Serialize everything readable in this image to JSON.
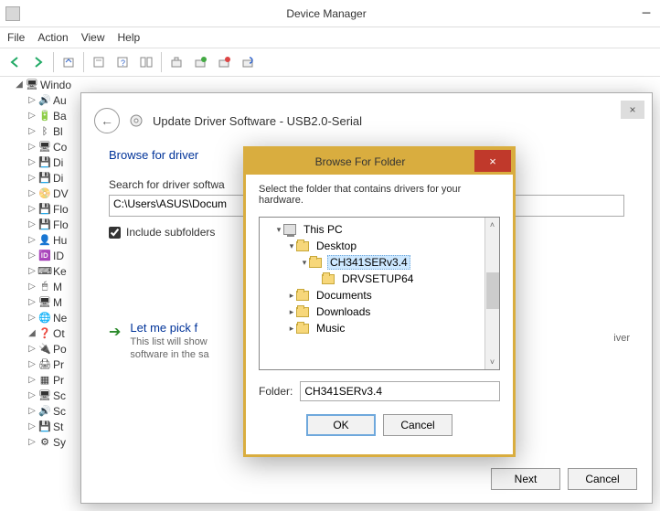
{
  "window": {
    "title": "Device Manager",
    "minimize": "−"
  },
  "menu": {
    "file": "File",
    "action": "Action",
    "view": "View",
    "help": "Help"
  },
  "toolbar_icons": {
    "back": "back-arrow",
    "fwd": "forward-arrow",
    "up": "up-arrow-device",
    "props": "properties",
    "scan": "scan-hardware",
    "refresh": "refresh",
    "details": "details",
    "resources": "resources",
    "uninstall": "uninstall",
    "update": "update-driver",
    "disable": "disable",
    "enable": "enable"
  },
  "tree": {
    "root": "Windo",
    "items": [
      "Au",
      "Ba",
      "Bl",
      "Co",
      "Di",
      "Di",
      "DV",
      "Flo",
      "Flo",
      "Hu",
      "ID",
      "Ke",
      "M",
      "M",
      "Ne",
      "Ot",
      "Po",
      "Pr",
      "Pr",
      "Sc",
      "Sc",
      "St",
      "Sy"
    ],
    "selected_index": 15
  },
  "update_dialog": {
    "close_x": "×",
    "title_prefix": "Update Driver Software - ",
    "title_device": "USB2.0-Serial",
    "heading": "Browse for driver",
    "search_label": "Search for driver softwa",
    "path_value": "C:\\Users\\ASUS\\Docum",
    "include_subfolders": "Include subfolders",
    "include_subfolders_checked": true,
    "pick_title": "Let me pick f",
    "pick_sub1": "This list will show",
    "pick_sub2": "software in the sa",
    "pick_sub_right": "iver",
    "next": "Next",
    "cancel": "Cancel"
  },
  "browse_dialog": {
    "title": "Browse For Folder",
    "close_x": "×",
    "intro": "Select the folder that contains drivers for your hardware.",
    "tree": [
      {
        "label": "This PC",
        "indent": 1,
        "exp": "▾",
        "icon": "pc"
      },
      {
        "label": "Desktop",
        "indent": 2,
        "exp": "▾",
        "icon": "folder"
      },
      {
        "label": "CH341SERv3.4",
        "indent": 3,
        "exp": "▾",
        "icon": "folder",
        "selected": true
      },
      {
        "label": "DRVSETUP64",
        "indent": 4,
        "exp": "",
        "icon": "folder"
      },
      {
        "label": "Documents",
        "indent": 2,
        "exp": "▸",
        "icon": "folder"
      },
      {
        "label": "Downloads",
        "indent": 2,
        "exp": "▸",
        "icon": "folder"
      },
      {
        "label": "Music",
        "indent": 2,
        "exp": "▸",
        "icon": "folder"
      }
    ],
    "folder_label": "Folder:",
    "folder_value": "CH341SERv3.4",
    "ok": "OK",
    "cancel": "Cancel"
  }
}
